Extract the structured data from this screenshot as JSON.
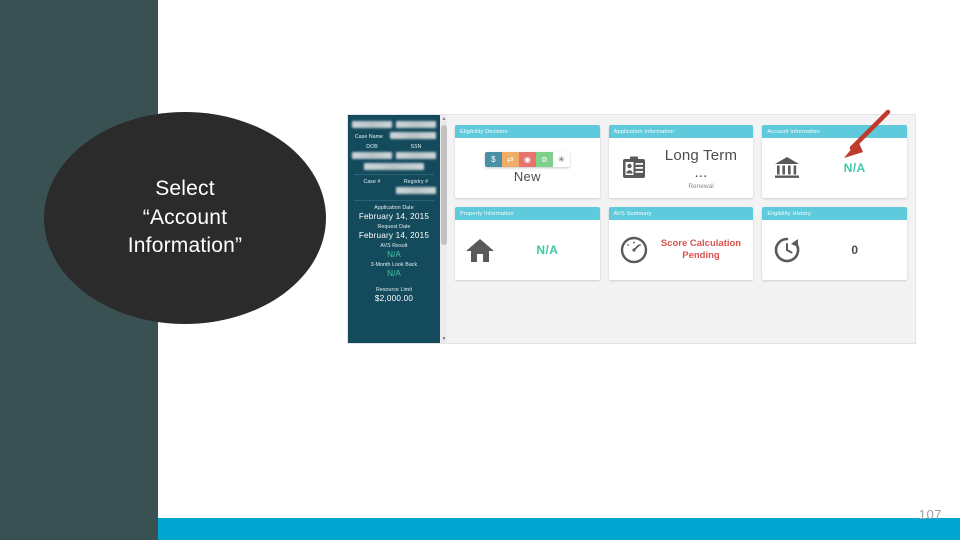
{
  "slide": {
    "page_number": "107",
    "callout_text": "Select\n“Account\nInformation”",
    "colors": {
      "left_band": "#3a5153",
      "bottom_bar": "#00a6cf",
      "callout_fill": "#2b2b2b",
      "card_header": "#5ecadb",
      "sidebar": "#134a5c",
      "accent_green": "#3fc9a6",
      "accent_red": "#d9534f",
      "arrow": "#c0392b"
    }
  },
  "sidebar": {
    "case_name_label": "Case Name",
    "dob_label": "DOB",
    "ssn_label": "SSN",
    "case_number_label": "Case #",
    "registry_number_label": "Registry #",
    "fields": [
      {
        "label": "Application Date",
        "value": "February 14, 2015",
        "style": "white"
      },
      {
        "label": "Request Date",
        "value": "February 14, 2015",
        "style": "white"
      },
      {
        "label": "AVS Result",
        "value": "N/A",
        "style": "green"
      },
      {
        "label": "3-Month Look Back",
        "value": "N/A",
        "style": "green"
      },
      {
        "label": "Resource Limit",
        "value": "$2,000.00",
        "style": "white"
      }
    ]
  },
  "cards": [
    {
      "title": "Eligibility Decision",
      "layout": "strip",
      "value": "New",
      "icon": "decision-steps-icon",
      "steps": [
        {
          "name": "dollar-step-icon",
          "glyph": "$",
          "color": "#4a90a4"
        },
        {
          "name": "pending-step-icon",
          "glyph": "⇄",
          "color": "#f0ad68"
        },
        {
          "name": "alert-step-icon",
          "glyph": "◉",
          "color": "#e8736c"
        },
        {
          "name": "approved-step-icon",
          "glyph": "⊜",
          "color": "#7fd08a"
        },
        {
          "name": "settings-step-icon",
          "glyph": "✳",
          "color": "#ffffff"
        }
      ]
    },
    {
      "title": "Application Information",
      "layout": "icon-text",
      "icon": "id-card-icon",
      "value": "Long Term ...",
      "subvalue": "Renewal"
    },
    {
      "title": "Account Information",
      "layout": "icon-text",
      "icon": "bank-icon",
      "value": "N/A",
      "value_style": "green"
    },
    {
      "title": "Property Information",
      "layout": "icon-text",
      "icon": "house-icon",
      "value": "N/A",
      "value_style": "green"
    },
    {
      "title": "AVS Summary",
      "layout": "icon-text",
      "icon": "gauge-icon",
      "value": "Score Calculation Pending",
      "value_style": "red"
    },
    {
      "title": "Eligibility History",
      "layout": "icon-text",
      "icon": "clock-history-icon",
      "value": "0",
      "value_style": "dark"
    }
  ]
}
